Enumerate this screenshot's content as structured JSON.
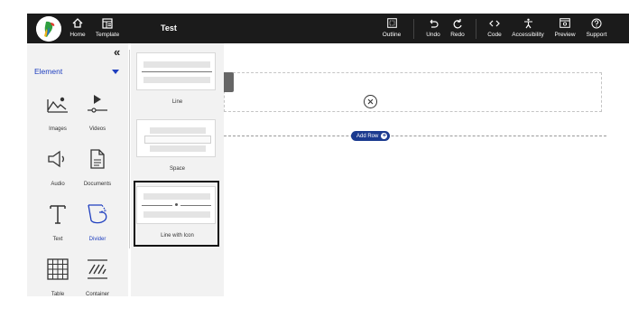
{
  "topbar": {
    "title": "Test",
    "buttons": [
      {
        "label": "Home",
        "icon": "home-icon"
      },
      {
        "label": "Template",
        "icon": "template-icon"
      },
      {
        "label": "Outline",
        "icon": "outline-icon"
      },
      {
        "label": "Undo",
        "icon": "undo-icon"
      },
      {
        "label": "Redo",
        "icon": "redo-icon"
      },
      {
        "label": "Code",
        "icon": "code-icon"
      },
      {
        "label": "Accessibility",
        "icon": "accessibility-icon"
      },
      {
        "label": "Preview",
        "icon": "preview-icon"
      },
      {
        "label": "Support",
        "icon": "support-icon"
      }
    ]
  },
  "element_panel": {
    "collapse": "«",
    "header": "Element",
    "items": [
      {
        "label": "Images",
        "icon": "image-icon"
      },
      {
        "label": "Videos",
        "icon": "video-icon"
      },
      {
        "label": "Audio",
        "icon": "audio-icon"
      },
      {
        "label": "Documents",
        "icon": "document-icon"
      },
      {
        "label": "Text",
        "icon": "text-icon"
      },
      {
        "label": "Divider",
        "icon": "divider-icon",
        "active": true
      },
      {
        "label": "Table",
        "icon": "table-icon"
      },
      {
        "label": "Container",
        "icon": "container-icon"
      }
    ]
  },
  "divider_panel": {
    "variants": [
      {
        "label": "Line"
      },
      {
        "label": "Space"
      },
      {
        "label": "Line with Icon",
        "selected": true
      }
    ]
  },
  "canvas": {
    "add_row": "Add Row"
  },
  "colors": {
    "accent": "#1f3fbf",
    "topbar": "#1b1b1b",
    "add_row_bg": "#1b3a8f"
  }
}
